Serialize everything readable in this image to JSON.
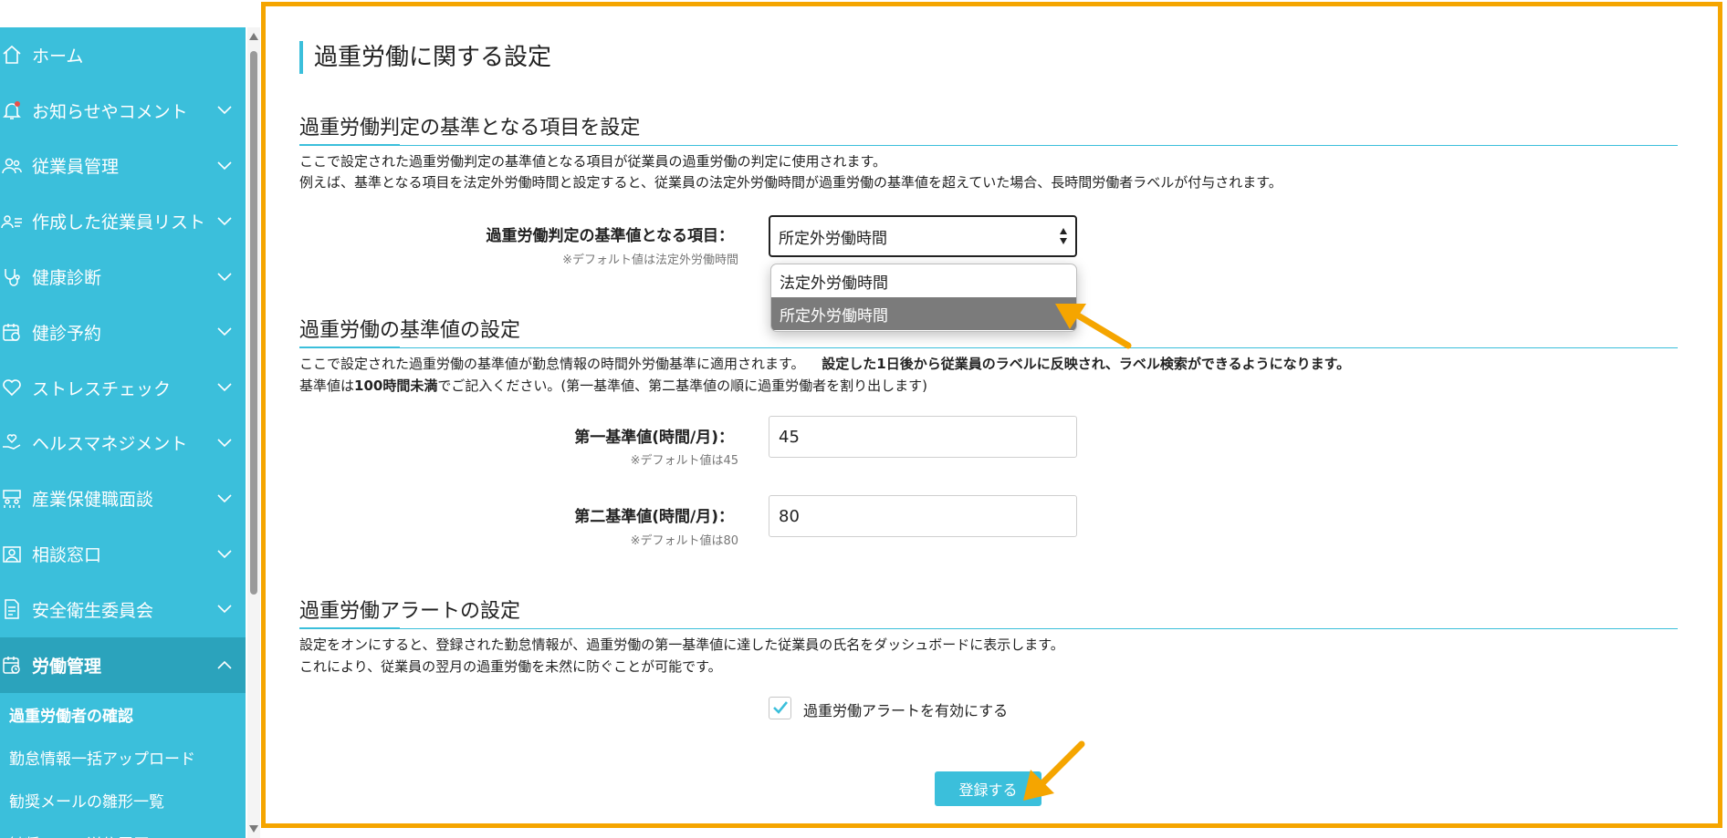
{
  "sidebar": {
    "items": [
      {
        "icon": "home-icon",
        "label": "ホーム",
        "has_chevron": false
      },
      {
        "icon": "bell-icon",
        "label": "お知らせやコメント",
        "has_chevron": true
      },
      {
        "icon": "users-icon",
        "label": "従業員管理",
        "has_chevron": true
      },
      {
        "icon": "user-list-icon",
        "label": "作成した従業員リスト",
        "has_chevron": true
      },
      {
        "icon": "stethoscope-icon",
        "label": "健康診断",
        "has_chevron": true
      },
      {
        "icon": "calendar-icon",
        "label": "健診予約",
        "has_chevron": true
      },
      {
        "icon": "heart-icon",
        "label": "ストレスチェック",
        "has_chevron": true
      },
      {
        "icon": "hand-heart-icon",
        "label": "ヘルスマネジメント",
        "has_chevron": true
      },
      {
        "icon": "meeting-icon",
        "label": "産業保健職面談",
        "has_chevron": true
      },
      {
        "icon": "consult-icon",
        "label": "相談窓口",
        "has_chevron": true
      },
      {
        "icon": "document-icon",
        "label": "安全衛生委員会",
        "has_chevron": true
      },
      {
        "icon": "clock-calendar-icon",
        "label": "労働管理",
        "has_chevron": true,
        "expanded": true
      }
    ],
    "subitems": [
      {
        "label": "過重労働者の確認",
        "current": true
      },
      {
        "label": "勤怠情報一括アップロード",
        "current": false
      },
      {
        "label": "勧奨メールの雛形一覧",
        "current": false
      },
      {
        "label": "勧奨メール送信履歴",
        "current": false
      }
    ]
  },
  "main": {
    "page_title": "過重労働に関する設定",
    "section1": {
      "title": "過重労働判定の基準となる項目を設定",
      "desc1": "ここで設定された過重労働判定の基準値となる項目が従業員の過重労働の判定に使用されます。",
      "desc2": "例えば、基準となる項目を法定外労働時間と設定すると、従業員の法定外労働時間が過重労働の基準値を超えていた場合、長時間労働者ラベルが付与されます。",
      "field_label": "過重労働判定の基準値となる項目：",
      "field_hint": "※デフォルト値は法定外労働時間",
      "selected_value": "所定外労働時間",
      "options": [
        "法定外労働時間",
        "所定外労働時間"
      ]
    },
    "section2": {
      "title": "過重労働の基準値の設定",
      "desc1_normal": "ここで設定された過重労働の基準値が勤怠情報の時間外労働基準に適用されます。",
      "desc1_bold": "設定した1日後から従業員のラベルに反映され、ラベル検索ができるようになります。",
      "desc2_pre": "基準値は",
      "desc2_bold": "100時間未満",
      "desc2_post": "でご記入ください。(第一基準値、第二基準値の順に過重労働者を割り出します)",
      "first_label": "第一基準値(時間/月)：",
      "first_hint": "※デフォルト値は45",
      "first_value": "45",
      "second_label": "第二基準値(時間/月)：",
      "second_hint": "※デフォルト値は80",
      "second_value": "80"
    },
    "section3": {
      "title": "過重労働アラートの設定",
      "desc1": "設定をオンにすると、登録された勤怠情報が、過重労働の第一基準値に達した従業員の氏名をダッシュボードに表示します。",
      "desc2": "これにより、従業員の翌月の過重労働を未然に防ぐことが可能です。",
      "checkbox_label": "過重労働アラートを有効にする",
      "checkbox_checked": true
    },
    "submit_label": "登録する"
  },
  "colors": {
    "sidebar_bg": "#3bbfdb",
    "sidebar_active": "#2ba3bc",
    "accent": "#3bbfdb",
    "annotation": "#f5a500",
    "dropdown_selected": "#7b7b7b"
  }
}
